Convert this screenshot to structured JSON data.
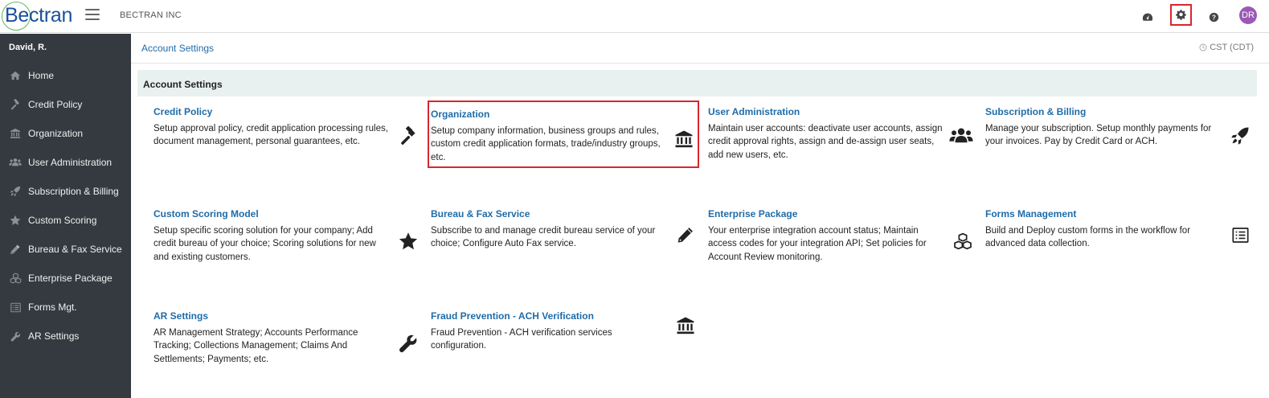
{
  "header": {
    "logo_text": "Bectran",
    "company_name": "BECTRAN INC",
    "avatar_initials": "DR",
    "avatar_color": "#9b59b6",
    "highlight_color": "#d9262c"
  },
  "sidebar": {
    "user_name": "David, R.",
    "items": [
      {
        "label": "Home",
        "icon": "home-icon"
      },
      {
        "label": "Credit Policy",
        "icon": "gavel-icon"
      },
      {
        "label": "Organization",
        "icon": "bank-icon"
      },
      {
        "label": "User Administration",
        "icon": "users-icon"
      },
      {
        "label": "Subscription & Billing",
        "icon": "rocket-icon"
      },
      {
        "label": "Custom Scoring",
        "icon": "star-icon"
      },
      {
        "label": "Bureau & Fax Service",
        "icon": "pencil-icon"
      },
      {
        "label": "Enterprise Package",
        "icon": "cubes-icon"
      },
      {
        "label": "Forms Mgt.",
        "icon": "list-icon"
      },
      {
        "label": "AR Settings",
        "icon": "wrench-icon"
      }
    ]
  },
  "main": {
    "breadcrumb": "Account Settings",
    "timezone": "CST (CDT)",
    "panel_title": "Account Settings",
    "cards": [
      {
        "title": "Credit Policy",
        "desc": "Setup approval policy, credit application processing rules, document management, personal guarantees, etc.",
        "icon": "gavel-icon"
      },
      {
        "title": "Organization",
        "desc": "Setup company information, business groups and rules, custom credit application formats, trade/industry groups, etc.",
        "icon": "bank-icon"
      },
      {
        "title": "User Administration",
        "desc": "Maintain user accounts: deactivate user accounts, assign credit approval rights, assign and de-assign user seats, add new users, etc.",
        "icon": "users-icon"
      },
      {
        "title": "Subscription & Billing",
        "desc": "Manage your subscription. Setup monthly payments for your invoices. Pay by Credit Card or ACH.",
        "icon": "rocket-icon"
      },
      {
        "title": "Custom Scoring Model",
        "desc": "Setup specific scoring solution for your company; Add credit bureau of your choice; Scoring solutions for new and existing customers.",
        "icon": "star-icon"
      },
      {
        "title": "Bureau & Fax Service",
        "desc": "Subscribe to and manage credit bureau service of your choice; Configure Auto Fax service.",
        "icon": "pencil-icon"
      },
      {
        "title": "Enterprise Package",
        "desc": "Your enterprise integration account status; Maintain access codes for your integration API; Set policies for Account Review monitoring.",
        "icon": "cubes-icon"
      },
      {
        "title": "Forms Management",
        "desc": "Build and Deploy custom forms in the workflow for advanced data collection.",
        "icon": "list-icon"
      },
      {
        "title": "AR Settings",
        "desc": "AR Management Strategy; Accounts Performance Tracking; Collections Management; Claims And Settlements; Payments; etc.",
        "icon": "wrench-icon"
      },
      {
        "title": "Fraud Prevention - ACH Verification",
        "desc": "Fraud Prevention - ACH verification services configuration.",
        "icon": "bank-icon"
      }
    ]
  }
}
